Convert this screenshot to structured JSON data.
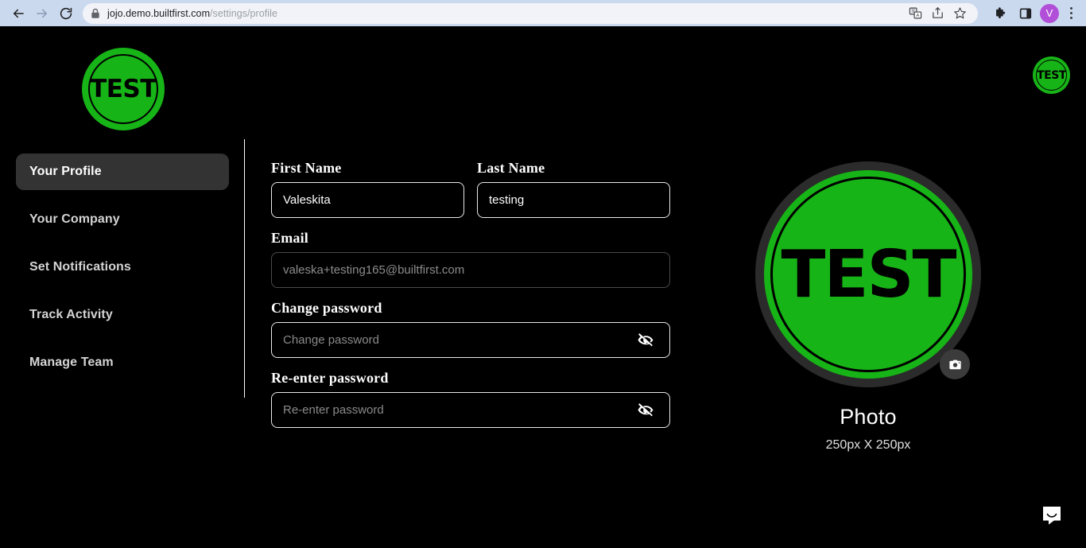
{
  "browser": {
    "back_label": "Back",
    "forward_label": "Forward",
    "reload_label": "Reload",
    "lock_icon": "lock-icon",
    "url_domain": "jojo.demo.builtfirst.com",
    "url_path": "/settings/profile",
    "url_full": "jojo.demo.builtfirst.com/settings/profile",
    "actions": [
      {
        "name": "translate-icon",
        "label": "Translate this page"
      },
      {
        "name": "share-icon",
        "label": "Share this page"
      },
      {
        "name": "bookmark-star-icon",
        "label": "Bookmark this tab"
      }
    ],
    "toolbar": [
      {
        "name": "extensions-puzzle-icon",
        "label": "Extensions"
      },
      {
        "name": "side-panel-icon",
        "label": "Side panel"
      }
    ],
    "profile_initial": "V",
    "menu_label": "Customize and control Google Chrome"
  },
  "header": {
    "logo_text": "TEST",
    "avatar_text": "TEST"
  },
  "sidebar": {
    "items": [
      {
        "label": "Your Profile",
        "active": true
      },
      {
        "label": "Your Company",
        "active": false
      },
      {
        "label": "Set Notifications",
        "active": false
      },
      {
        "label": "Track Activity",
        "active": false
      },
      {
        "label": "Manage Team",
        "active": false
      }
    ]
  },
  "form": {
    "first_name": {
      "label": "First Name",
      "value": "Valeskita",
      "placeholder": "First Name"
    },
    "last_name": {
      "label": "Last Name",
      "value": "testing",
      "placeholder": "Last Name"
    },
    "email": {
      "label": "Email",
      "value": "valeska+testing165@builtfirst.com",
      "placeholder": "Email",
      "disabled": true
    },
    "change_password": {
      "label": "Change password",
      "value": "",
      "placeholder": "Change password",
      "toggle_icon": "eye-off-icon"
    },
    "reenter_password": {
      "label": "Re-enter password",
      "value": "",
      "placeholder": "Re-enter password",
      "toggle_icon": "eye-off-icon"
    }
  },
  "photo": {
    "avatar_text": "TEST",
    "camera_icon": "camera-icon",
    "title": "Photo",
    "dimensions": "250px X 250px"
  },
  "chat": {
    "icon": "chat-bubble-icon",
    "label": "Open chat"
  },
  "colors": {
    "brand_green": "#17b417",
    "page_background": "#000000",
    "active_nav_background": "#333333",
    "avatar_ring": "#2b2b2b",
    "browser_chrome": "#cbd9ef",
    "profile_avatar": "#b14fd8"
  }
}
